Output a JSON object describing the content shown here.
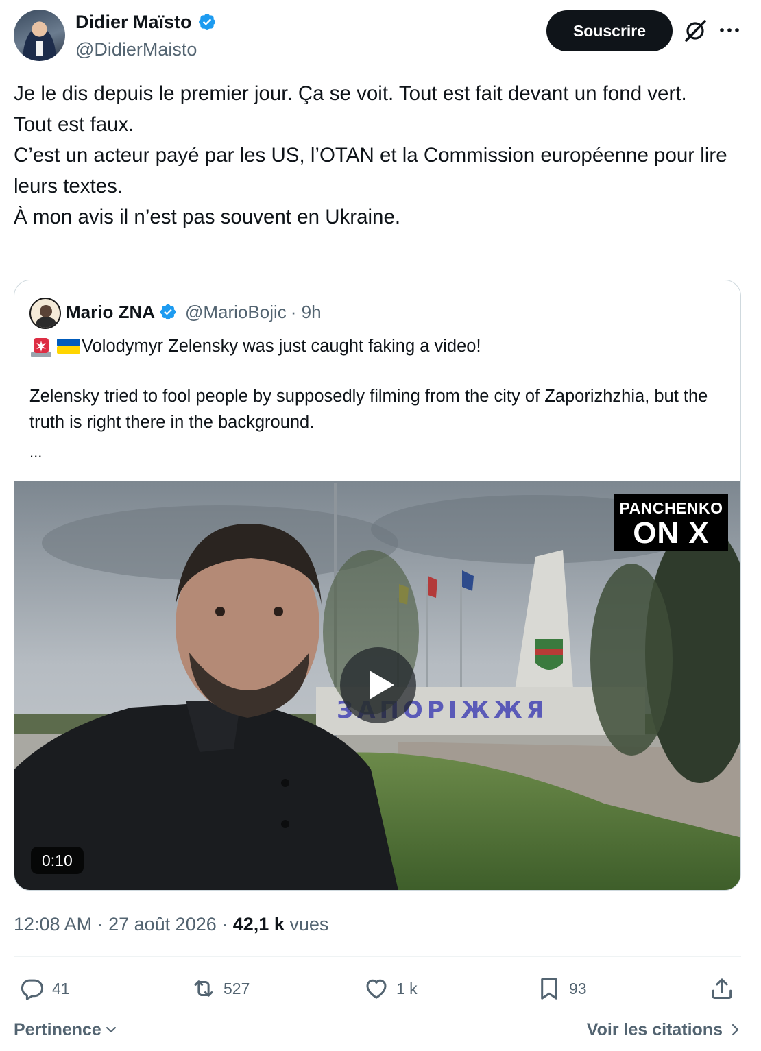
{
  "author": {
    "name": "Didier Maïsto",
    "handle": "@DidierMaisto",
    "verified": true
  },
  "header": {
    "subscribe_label": "Souscrire",
    "grok_icon": "grok-icon",
    "more_icon": "more-icon"
  },
  "tweet": {
    "text": "Je le dis depuis le premier jour. Ça se voit. Tout est fait devant un fond vert.\nTout est faux.\nC’est un acteur payé par les US, l’OTAN et la Commission européenne pour lire leurs textes.\nÀ mon avis il n’est pas souvent en Ukraine."
  },
  "quote": {
    "name": "Mario ZNA",
    "handle": "@MarioBojic",
    "time": "· 9h",
    "line1": "Volodymyr Zelensky was just caught faking a video!",
    "body": "Zelensky tried to fool people by supposedly filming from the city of Zaporizhzhia, but the truth is right there in the background.",
    "ellipsis": "...",
    "video": {
      "watermark_top": "PANCHENKO",
      "watermark_bottom": "ON X",
      "sign_text": "ЗАПОРІЖЖЯ",
      "duration": "0:10"
    }
  },
  "meta": {
    "time": "12:08 AM",
    "date": "27 août 2026",
    "views_count": "42,1 k",
    "views_label": "vues"
  },
  "actions": {
    "replies": "41",
    "reposts": "527",
    "likes": "1 k",
    "bookmarks": "93"
  },
  "footer": {
    "sort_label": "Pertinence",
    "quotes_label": "Voir les citations"
  },
  "colors": {
    "verified": "#1d9bf0",
    "text": "#0f1419",
    "secondary": "#536471",
    "border": "#cfd9de"
  }
}
